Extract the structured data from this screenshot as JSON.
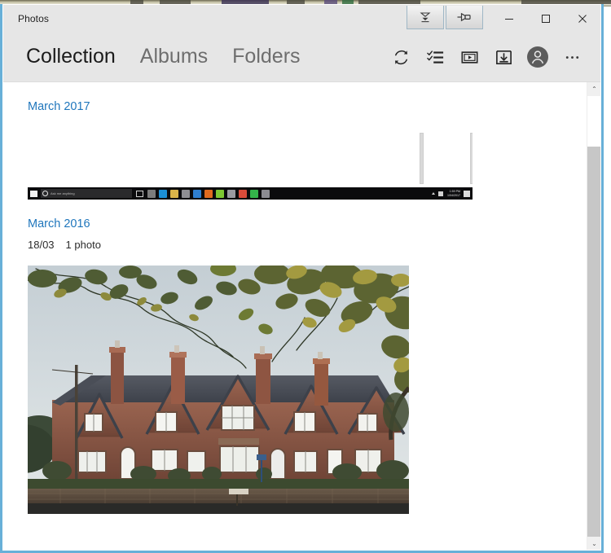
{
  "window": {
    "title": "Photos",
    "controls": {
      "minimize": "─",
      "maximize": "☐",
      "close": "✕"
    },
    "capture_buttons": [
      {
        "name": "scroll-capture-button",
        "tooltip": "Scrolling capture"
      },
      {
        "name": "pin-capture-button",
        "tooltip": "Pin capture"
      }
    ]
  },
  "nav": {
    "tabs": [
      {
        "label": "Collection",
        "active": true
      },
      {
        "label": "Albums",
        "active": false
      },
      {
        "label": "Folders",
        "active": false
      }
    ]
  },
  "toolbar": {
    "items": [
      {
        "name": "refresh-icon",
        "label": "Refresh"
      },
      {
        "name": "select-icon",
        "label": "Select"
      },
      {
        "name": "slideshow-icon",
        "label": "Slideshow"
      },
      {
        "name": "import-icon",
        "label": "Import"
      },
      {
        "name": "account-avatar-icon",
        "label": "Account"
      },
      {
        "name": "more-icon",
        "label": "See more"
      }
    ],
    "more_glyph": "···"
  },
  "content": {
    "groups": [
      {
        "month": "March 2017",
        "day": "",
        "count": "",
        "thumbnail": {
          "type": "screenshot",
          "taskbar_search_placeholder": "Ask me anything",
          "clock_time": "1:59 PM",
          "clock_date": "1/04/2017",
          "icon_colors": [
            "#7c7c7c",
            "#1b8fd6",
            "#d9b44a",
            "#8f8f93",
            "#2f7fd0",
            "#e06a1e",
            "#7ec832",
            "#9a9aa0",
            "#d94b3a",
            "#34b44a",
            "#8c8c92"
          ]
        }
      },
      {
        "month": "March 2016",
        "day": "18/03",
        "count": "1 photo",
        "thumbnail": {
          "type": "photo",
          "description": "Row of Victorian brick almshouses with tall chimneys under autumn trees"
        }
      }
    ]
  },
  "scrollbar": {
    "up_glyph": "⌃",
    "down_glyph": "⌄"
  },
  "colors": {
    "accent_blue": "#1f76bc",
    "window_border": "#68b0d8",
    "chrome": "#e6e6e6",
    "text_primary": "#1b1b1b",
    "text_muted": "#6e6e6e"
  }
}
